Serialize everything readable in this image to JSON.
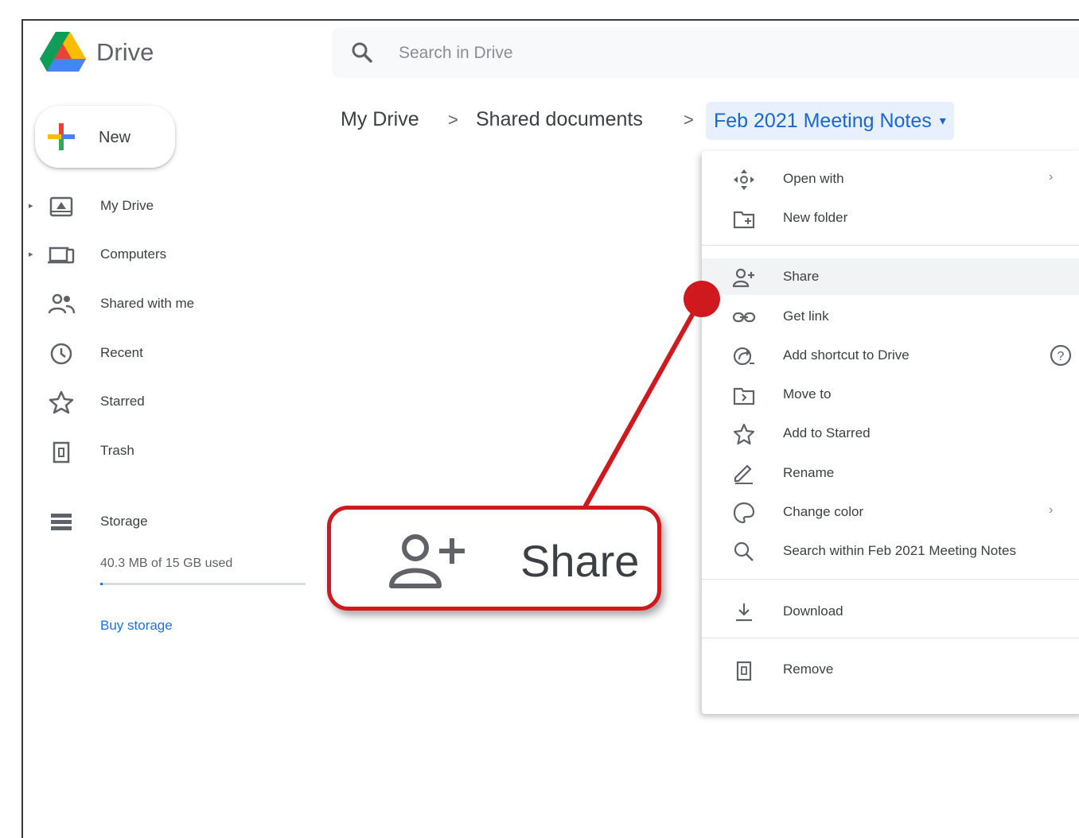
{
  "app": {
    "title": "Drive"
  },
  "search": {
    "placeholder": "Search in Drive"
  },
  "new_button": {
    "label": "New"
  },
  "sidebar": {
    "items": [
      {
        "label": "My Drive",
        "icon": "my-drive-icon",
        "has_caret": true
      },
      {
        "label": "Computers",
        "icon": "computers-icon",
        "has_caret": true
      },
      {
        "label": "Shared with me",
        "icon": "shared-with-me-icon",
        "has_caret": false
      },
      {
        "label": "Recent",
        "icon": "recent-icon",
        "has_caret": false
      },
      {
        "label": "Starred",
        "icon": "star-icon",
        "has_caret": false
      },
      {
        "label": "Trash",
        "icon": "trash-icon",
        "has_caret": false
      }
    ],
    "storage": {
      "label": "Storage",
      "usage_text": "40.3 MB of 15 GB used",
      "used_fraction": 0.003,
      "buy_label": "Buy storage"
    }
  },
  "breadcrumb": {
    "items": [
      "My Drive",
      "Shared documents"
    ],
    "current": "Feb 2021 Meeting Notes",
    "separator": ">"
  },
  "context_menu": {
    "items": [
      {
        "label": "Open with",
        "icon": "open-with-icon",
        "submenu": true
      },
      {
        "label": "New folder",
        "icon": "new-folder-icon"
      },
      {
        "label": "Share",
        "icon": "share-icon",
        "highlighted": true
      },
      {
        "label": "Get link",
        "icon": "link-icon"
      },
      {
        "label": "Add shortcut to Drive",
        "icon": "shortcut-icon",
        "help": true
      },
      {
        "label": "Move to",
        "icon": "move-to-icon"
      },
      {
        "label": "Add to Starred",
        "icon": "star-icon"
      },
      {
        "label": "Rename",
        "icon": "rename-icon"
      },
      {
        "label": "Change color",
        "icon": "palette-icon",
        "submenu": true
      },
      {
        "label": "Search within Feb 2021 Meeting Notes",
        "icon": "search-icon"
      },
      {
        "label": "Download",
        "icon": "download-icon"
      },
      {
        "label": "Remove",
        "icon": "trash-icon"
      }
    ]
  },
  "callout": {
    "label": "Share",
    "icon": "share-icon",
    "accent": "#d0191f"
  },
  "colors": {
    "accent": "#1a73e8",
    "callout": "#d0191f"
  }
}
